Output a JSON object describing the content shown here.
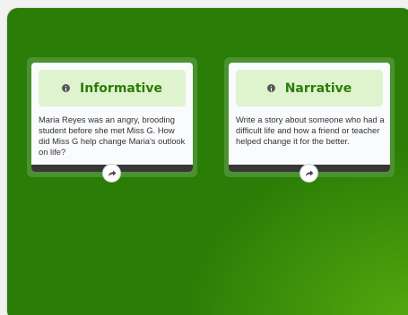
{
  "board": {
    "background_color": "#2a7d06",
    "highlight_color": "#55a80e"
  },
  "cards": [
    {
      "title": "Informative",
      "text": "Maria Reyes was an angry, brooding student before she met Miss G. How did Miss G help change Maria's outlook on life?",
      "icon": "info-icon",
      "action_icon": "share-icon"
    },
    {
      "title": "Narrative",
      "text": "Write a story about someone who had a difficult life and how a friend or teacher helped change it for the better.",
      "icon": "info-icon",
      "action_icon": "share-icon"
    }
  ],
  "colors": {
    "header_bg": "#dff3cf",
    "title": "#2a7d06",
    "card_frame": "#4a9230",
    "footer": "#373737"
  }
}
